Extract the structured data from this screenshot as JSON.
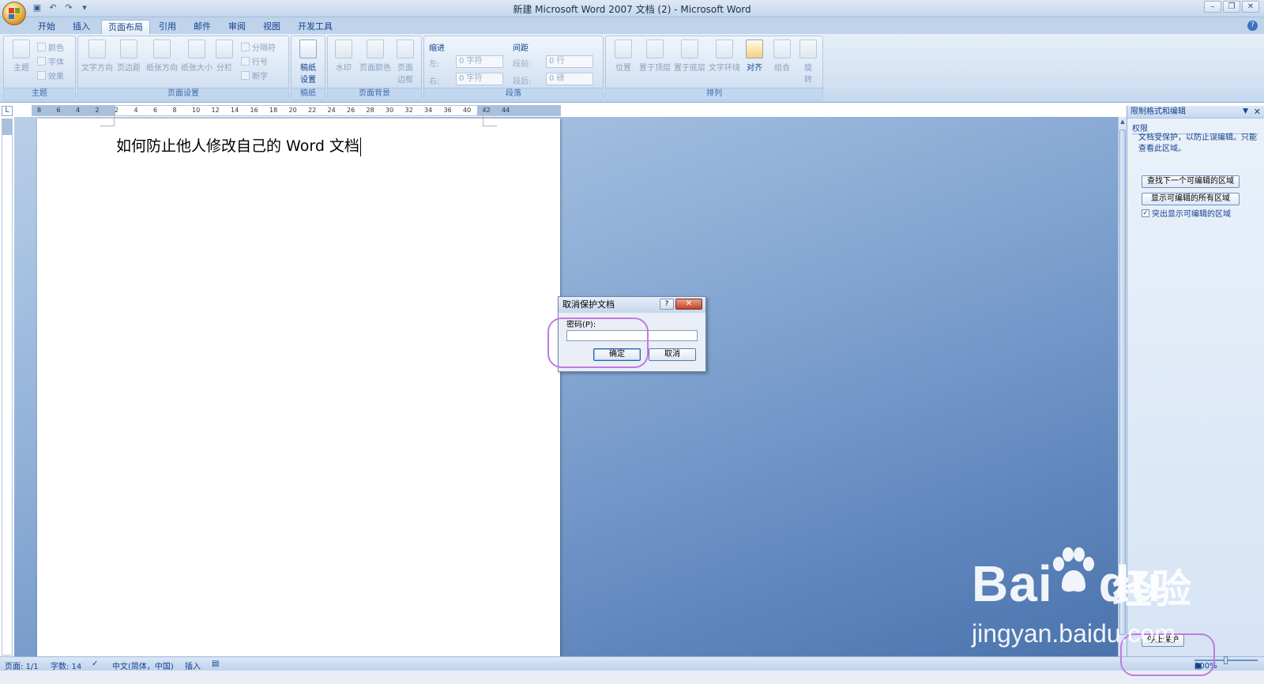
{
  "window": {
    "title": "新建 Microsoft Word 2007 文档 (2) - Microsoft Word",
    "controls": [
      "–",
      "❐",
      "✕"
    ]
  },
  "tabs": [
    "开始",
    "插入",
    "页面布局",
    "引用",
    "邮件",
    "审阅",
    "视图",
    "开发工具"
  ],
  "active_tab": "页面布局",
  "ribbon": {
    "theme": {
      "label": "主题",
      "btn": "主题",
      "colors": "颜色",
      "fonts": "字体",
      "effects": "效果"
    },
    "page_setup": {
      "label": "页面设置",
      "text_dir": "文字方向",
      "margins": "页边距",
      "orientation": "纸张方向",
      "size": "纸张大小",
      "columns": "分栏",
      "breaks": "分隔符",
      "line_numbers": "行号",
      "hyphen": "断字"
    },
    "manuscript": {
      "label": "稿纸",
      "btn": "稿纸设置"
    },
    "page_bg": {
      "label": "页面背景",
      "watermark": "水印",
      "page_color": "页面颜色",
      "page_border": "页面边框"
    },
    "paragraph": {
      "label": "段落",
      "indent": "缩进",
      "spacing": "间距",
      "left": "左:",
      "right": "右:",
      "before": "段前:",
      "after": "段后:",
      "left_val": "0 字符",
      "right_val": "0 字符",
      "before_val": "0 行",
      "after_val": "0 磅"
    },
    "arrange": {
      "label": "排列",
      "position": "位置",
      "bring_front": "置于顶层",
      "send_back": "置于底层",
      "wrap": "文字环绕",
      "align": "对齐",
      "group": "组合",
      "rotate": "旋转"
    }
  },
  "document": {
    "text": "如何防止他人修改自己的 Word 文档"
  },
  "ruler_numbers": [
    "8",
    "6",
    "4",
    "2",
    "2",
    "4",
    "6",
    "8",
    "10",
    "12",
    "14",
    "16",
    "18",
    "20",
    "22",
    "24",
    "26",
    "28",
    "30",
    "32",
    "34",
    "36",
    "40",
    "42",
    "44"
  ],
  "ruler_corner": "L",
  "task_pane": {
    "title": "限制格式和编辑",
    "section": "权限",
    "description": "文档受保护，以防止误编辑。只能查看此区域。",
    "btn_find_next": "查找下一个可编辑的区域",
    "btn_show_all": "显示可编辑的所有区域",
    "chk_highlight": "突出显示可编辑的区域",
    "chk_highlight_checked": true,
    "btn_stop": "停止保护"
  },
  "dialog": {
    "title": "取消保护文档",
    "help": "?",
    "close": "✕",
    "password_label": "密码(P):",
    "password_value": "",
    "ok": "确定",
    "cancel": "取消"
  },
  "status": {
    "page": "页面: 1/1",
    "words": "字数: 14",
    "language": "中文(简体，中国)",
    "mode": "插入",
    "zoom": "100%"
  },
  "watermark": {
    "brand": "Bai",
    "brand2": "du",
    "cn": "经验",
    "url": "jingyan.baidu.com"
  },
  "colors": {
    "accent": "#15428b",
    "annotation": "#c07ae0",
    "doc_bg": "#6a90c4"
  }
}
